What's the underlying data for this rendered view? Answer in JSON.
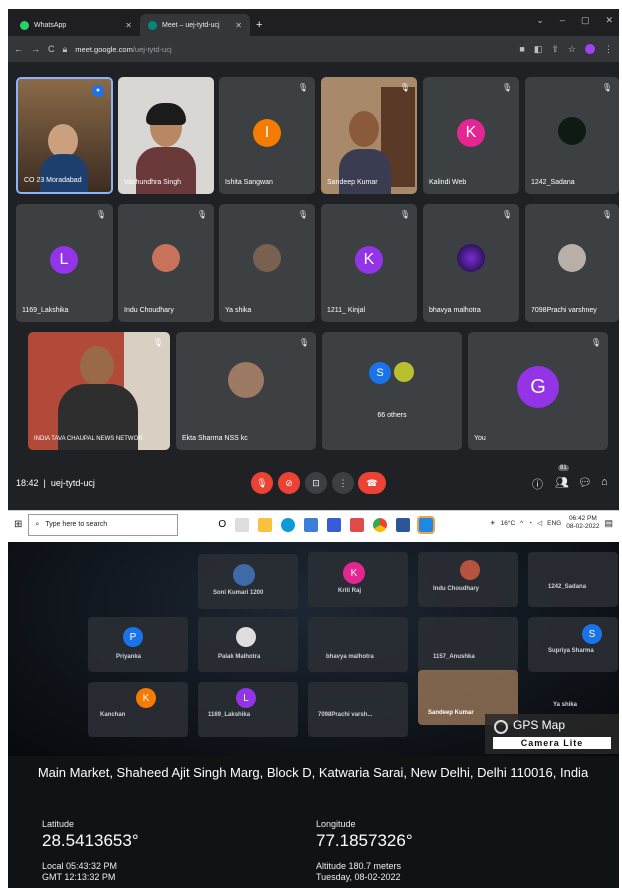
{
  "browser": {
    "tabs": [
      {
        "label": "WhatsApp",
        "color": "#25d366"
      },
      {
        "label": "Meet – uej-tytd-ucj",
        "color": "#00897b"
      }
    ],
    "url_host": "meet.google.com",
    "url_path": "/uej-tytd-ucj"
  },
  "meet": {
    "participants": [
      "CO 23 Moradabad",
      "Vashundhra Singh",
      "Ishita Sangwan",
      "Sandeep Kumar",
      "Kalindi Web",
      "1242_Sadana",
      "1169_Lakshika",
      "Indu Choudhary",
      "Ya shika",
      "1211_ Kinjal",
      "bhavya malhotra",
      "7098Prachi varshney",
      "INDIA TAVA CHAUPAL NEWS NETWOR",
      "Ekta Sharma NSS kc",
      "66 others",
      "You"
    ],
    "avatars": {
      "ishita": "I",
      "kalindi": "K",
      "lakshika": "L",
      "kinjal": "K",
      "others": "S",
      "you": "G"
    },
    "time": "18:42",
    "meeting_code": "uej-tytd-ucj",
    "people_count": "81"
  },
  "taskbar": {
    "search_placeholder": "Type here to search",
    "temp": "16°C",
    "lang": "ENG",
    "clock_time": "06:42 PM",
    "clock_date": "08-02-2022"
  },
  "photo2": {
    "background_names": [
      "Soni Kumari 1200",
      "Kriti Raj",
      "Indu Choudhary",
      "1242_Sadana",
      "Priyanka",
      "Palak Malhotra",
      "bhavya malhotra",
      "1157_Anushka",
      "Supriya Sharma",
      "Kanchan",
      "1169_Lakshika",
      "7098Prachi varsh...",
      "Sandeep Kumar",
      "Ya shika"
    ],
    "gps_title": "GPS Map",
    "gps_subtitle": "Camera Lite",
    "address": "Main Market, Shaheed Ajit Singh Marg, Block D, Katwaria Sarai, New Delhi, Delhi 110016, India",
    "latitude_label": "Latitude",
    "latitude": "28.5413653°",
    "longitude_label": "Longitude",
    "longitude": "77.1857326°",
    "local_time": "Local 05:43:32 PM",
    "gmt_time": "GMT 12:13:32 PM",
    "altitude": "Altitude 180.7 meters",
    "date": "Tuesday, 08-02-2022"
  }
}
